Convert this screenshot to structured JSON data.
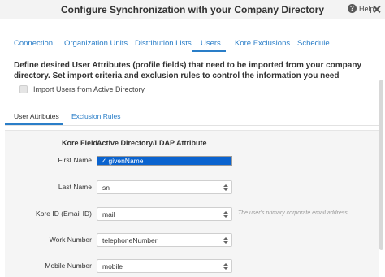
{
  "dialog": {
    "title": "Configure Synchronization with your Company Directory",
    "help_label": "Help"
  },
  "tabs": [
    {
      "label": "Connection"
    },
    {
      "label": "Organization Units"
    },
    {
      "label": "Distribution Lists"
    },
    {
      "label": "Users",
      "active": true
    },
    {
      "label": "Kore Exclusions"
    },
    {
      "label": "Schedule"
    }
  ],
  "description": "Define desired User Attributes (profile fields) that need to be imported from your company directory. Set import criteria and exclusion rules to control the information you need",
  "import_checkbox": {
    "label": "Import Users from Active Directory",
    "checked": false
  },
  "subtabs": [
    {
      "label": "User Attributes",
      "active": true
    },
    {
      "label": "Exclusion Rules"
    }
  ],
  "attributes": {
    "col_kore_field": "Kore Field",
    "col_ldap_attribute": "Active Directory/LDAP Attribute",
    "rows": [
      {
        "label": "First Name",
        "value": "givenName",
        "dropdown_open": true
      },
      {
        "label": "Last Name",
        "value": "sn"
      },
      {
        "label": "Kore ID (Email ID)",
        "value": "mail",
        "hint": "The user's primary corporate email address"
      },
      {
        "label": "Work Number",
        "value": "telephoneNumber"
      },
      {
        "label": "Mobile Number",
        "value": "mobile"
      }
    ],
    "open_option": "✓ givenName"
  },
  "colors": {
    "accent": "#2a7ec8",
    "selected_option": "#0a63cf",
    "panel_bg": "#f5f5f5"
  }
}
